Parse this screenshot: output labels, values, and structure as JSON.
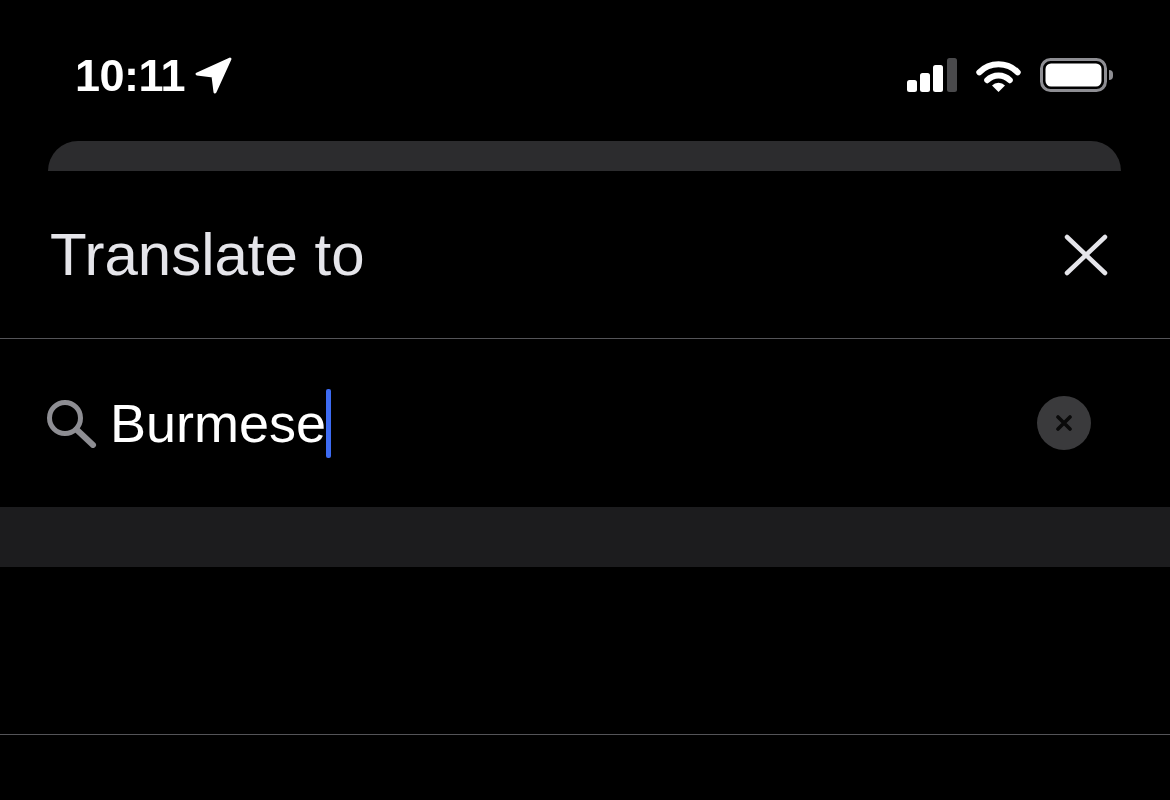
{
  "status_bar": {
    "time": "10:11"
  },
  "sheet": {
    "title": "Translate to"
  },
  "search": {
    "value": "Burmese",
    "focused": true
  }
}
